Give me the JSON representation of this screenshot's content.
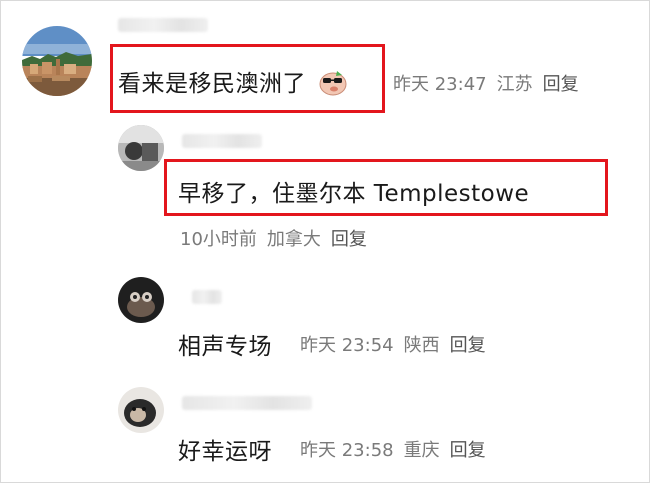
{
  "comments": [
    {
      "text": "看来是移民澳洲了",
      "emoji": "sunglasses-pig-emoji",
      "time": "昨天 23:47",
      "location": "江苏",
      "reply": "回复"
    },
    {
      "text": "早移了，住墨尔本 Templestowe",
      "time": "10小时前",
      "location": "加拿大",
      "reply": "回复"
    },
    {
      "text": "相声专场",
      "time": "昨天 23:54",
      "location": "陕西",
      "reply": "回复"
    },
    {
      "text": "好幸运呀",
      "time": "昨天 23:58",
      "location": "重庆",
      "reply": "回复"
    }
  ],
  "colors": {
    "highlight": "#e3161d",
    "meta_text": "#7a7a7a",
    "body_text": "#1a1a1a"
  }
}
